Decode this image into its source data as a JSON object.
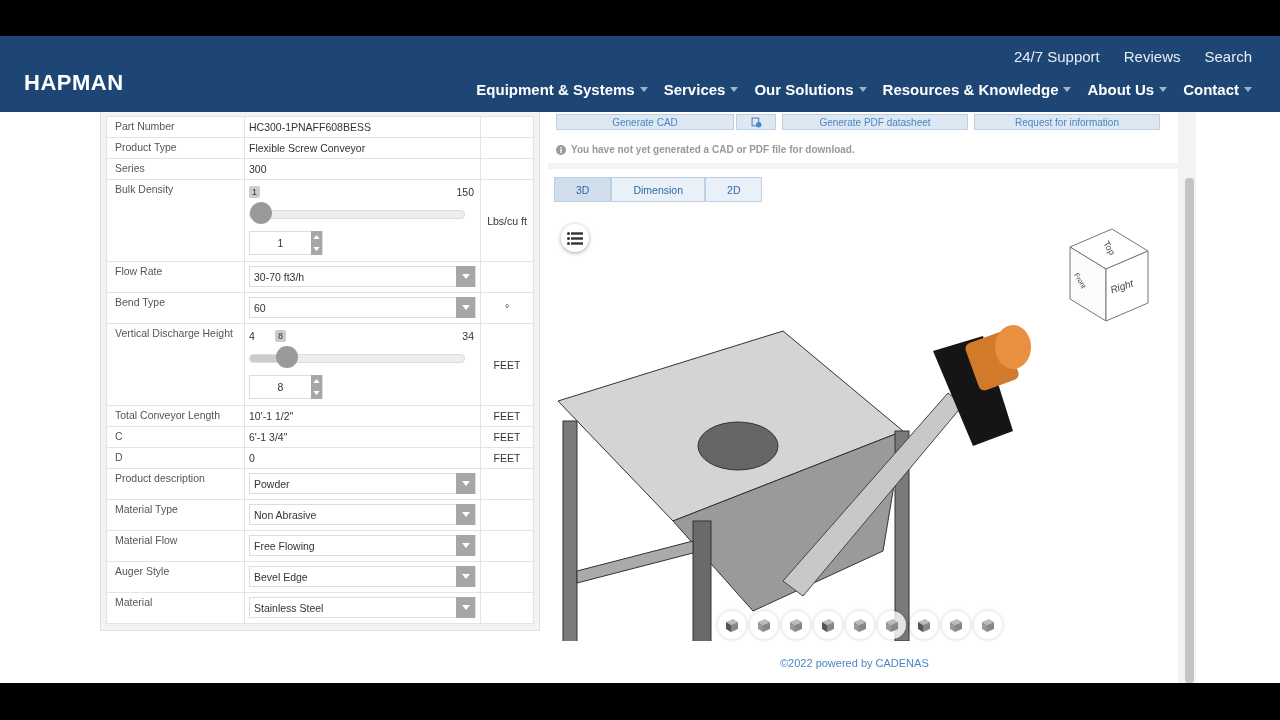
{
  "header": {
    "logo": "HAPMAN",
    "top_links": [
      "24/7 Support",
      "Reviews",
      "Search"
    ],
    "nav": [
      {
        "label": "Equipment & Systems"
      },
      {
        "label": "Services"
      },
      {
        "label": "Our Solutions"
      },
      {
        "label": "Resources & Knowledge"
      },
      {
        "label": "About Us"
      },
      {
        "label": "Contact"
      }
    ]
  },
  "spec_table": {
    "rows": [
      {
        "kind": "text",
        "label": "Part Number",
        "value": "HC300-1PNAFF608BESS"
      },
      {
        "kind": "text",
        "label": "Product Type",
        "value": "Flexible Screw Conveyor"
      },
      {
        "kind": "text",
        "label": "Series",
        "value": "300"
      },
      {
        "kind": "slider",
        "label": "Bulk Density",
        "badge": "1",
        "max": "150",
        "input": "1",
        "level": 0,
        "unit": "Lbs/cu ft"
      },
      {
        "kind": "select",
        "label": "Flow Rate",
        "value": "30-70 ft3/h"
      },
      {
        "kind": "select",
        "label": "Bend Type",
        "value": "60",
        "unit": "°"
      },
      {
        "kind": "slider",
        "label": "Vertical Discharge Height",
        "min": "4",
        "badge": "8",
        "max": "34",
        "input": "8",
        "level": 0.133,
        "unit": "FEET"
      },
      {
        "kind": "text",
        "label": "Total Conveyor Length",
        "value": "10'-1 1/2\"",
        "unit": "FEET"
      },
      {
        "kind": "text",
        "label": "C",
        "value": "6'-1 3/4\"",
        "unit": "FEET"
      },
      {
        "kind": "text",
        "label": "D",
        "value": "0",
        "unit": "FEET"
      },
      {
        "kind": "select",
        "label": "Product description",
        "value": "Powder"
      },
      {
        "kind": "select",
        "label": "Material Type",
        "value": "Non Abrasive"
      },
      {
        "kind": "select",
        "label": "Material Flow",
        "value": "Free Flowing"
      },
      {
        "kind": "select",
        "label": "Auger Style",
        "value": "Bevel Edge"
      },
      {
        "kind": "select",
        "label": "Material",
        "value": "Stainless Steel"
      }
    ]
  },
  "actions": {
    "buttons": [
      "Generate CAD",
      "Generate PDF datasheet",
      "Request for information"
    ],
    "notice": "You have not yet generated a CAD or PDF file for download."
  },
  "viewer": {
    "tabs": [
      {
        "label": "3D",
        "selected": true
      },
      {
        "label": "Dimension",
        "selected": false
      },
      {
        "label": "2D",
        "selected": false
      }
    ],
    "cube": {
      "top": "Top",
      "front": "Front",
      "right": "Right"
    },
    "footer": "©2022 powered by CADENAS"
  }
}
